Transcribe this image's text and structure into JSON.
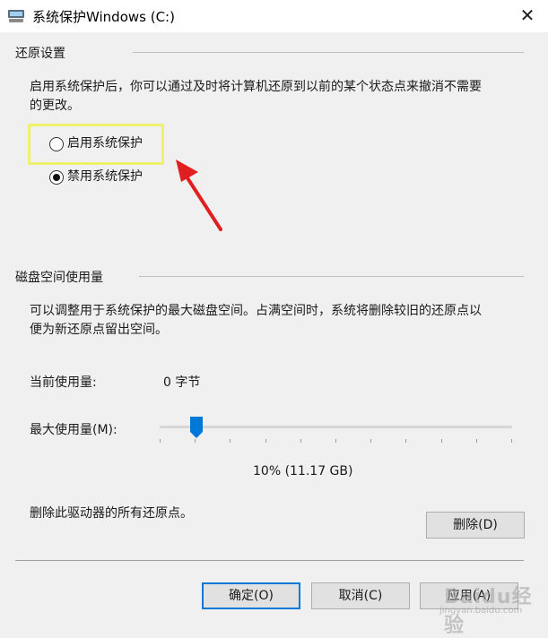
{
  "window": {
    "title": "系统保护Windows (C:)",
    "close_glyph": "✕"
  },
  "restore_settings": {
    "group_title": "还原设置",
    "description_line1": "启用系统保护后，你可以通过及时将计算机还原到以前的某个状态点来撤消不需要",
    "description_line2": "的更改。",
    "options": [
      {
        "label": "启用系统保护",
        "selected": false
      },
      {
        "label": "禁用系统保护",
        "selected": true
      }
    ]
  },
  "disk_usage": {
    "group_title": "磁盘空间使用量",
    "description_line1": "可以调整用于系统保护的最大磁盘空间。占满空间时，系统将删除较旧的还原点以",
    "description_line2": "便为新还原点留出空间。",
    "current_usage_label": "当前使用量:",
    "current_usage_value": "0 字节",
    "max_usage_label": "最大使用量(M):",
    "max_usage_fraction": 0.1,
    "max_usage_value": "10% (11.17 GB)",
    "delete_description": "删除此驱动器的所有还原点。",
    "delete_button": "删除(D)"
  },
  "footer": {
    "ok_button": "确定(O)",
    "cancel_button": "取消(C)",
    "apply_button": "应用(A)"
  },
  "watermark": {
    "brand": "Baidu经验",
    "url": "jingyan.baidu.com"
  },
  "colors": {
    "highlight": "#eef26a",
    "arrow": "#e02020",
    "accent": "#0078d7"
  }
}
